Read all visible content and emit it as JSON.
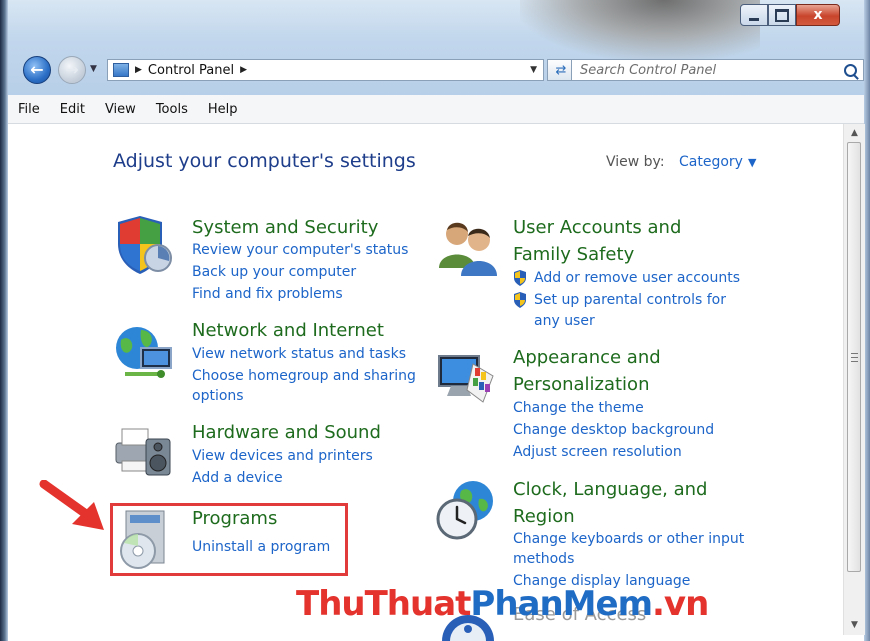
{
  "window": {
    "buttons": {
      "minimize": "minimize",
      "maximize": "maximize",
      "close": "x"
    }
  },
  "address_bar": {
    "breadcrumb": [
      "Control Panel"
    ],
    "search_placeholder": "Search Control Panel"
  },
  "menu": [
    "File",
    "Edit",
    "View",
    "Tools",
    "Help"
  ],
  "header": {
    "title": "Adjust your computer's settings",
    "view_by_label": "View by:",
    "view_by_value": "Category"
  },
  "categories_left": [
    {
      "title_lines": [
        "System and Security"
      ],
      "icon": "shield-icon",
      "links": [
        "Review your computer's status",
        "Back up your computer",
        "Find and fix problems"
      ]
    },
    {
      "title_lines": [
        "Network and Internet"
      ],
      "icon": "globe-network-icon",
      "links": [
        "View network status and tasks",
        "Choose homegroup and sharing",
        "options"
      ]
    },
    {
      "title_lines": [
        "Hardware and Sound"
      ],
      "icon": "printer-speaker-icon",
      "links": [
        "View devices and printers",
        "Add a device"
      ]
    },
    {
      "title_lines": [
        "Programs"
      ],
      "icon": "programs-disc-icon",
      "links": [
        "Uninstall a program"
      ]
    }
  ],
  "categories_right": [
    {
      "title_lines": [
        "User Accounts and",
        "Family Safety"
      ],
      "icon": "users-icon",
      "links": [
        "Add or remove user accounts",
        "Set up parental controls for",
        "any user"
      ]
    },
    {
      "title_lines": [
        "Appearance and",
        "Personalization"
      ],
      "icon": "monitor-palette-icon",
      "links": [
        "Change the theme",
        "Change desktop background",
        "Adjust screen resolution"
      ]
    },
    {
      "title_lines": [
        "Clock, Language, and",
        "Region"
      ],
      "icon": "clock-globe-icon",
      "links": [
        "Change keyboards or other input",
        "methods",
        "Change display language"
      ]
    },
    {
      "title_lines": [
        "Ease of Access"
      ],
      "icon": "ease-of-access-icon",
      "links": []
    }
  ],
  "watermark": {
    "part1": "ThuThuat",
    "part2": "PhanMem",
    "part3": ".vn"
  },
  "colors": {
    "title_blue": "#1e3d8a",
    "category_green": "#1e6b1e",
    "link_blue": "#1d65c9",
    "highlight_red": "#e23b3b"
  }
}
